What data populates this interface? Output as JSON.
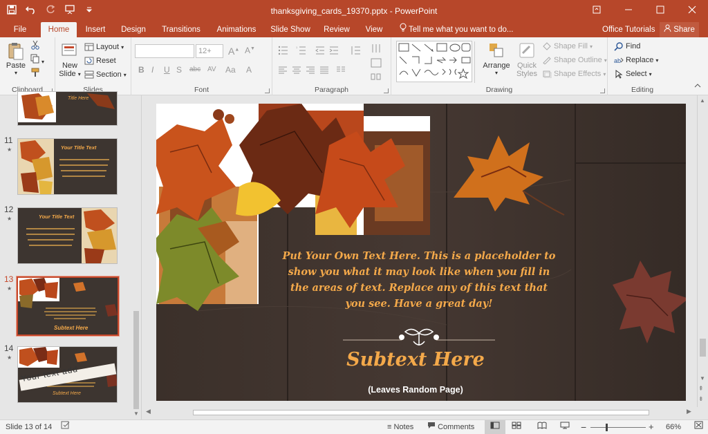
{
  "window": {
    "title": "thanksgiving_cards_19370.pptx - PowerPoint"
  },
  "qat": {
    "save": "save-icon",
    "undo": "undo-icon",
    "redo": "redo-icon",
    "present": "present-icon",
    "customize": "customize-icon"
  },
  "tabs": [
    {
      "label": "File"
    },
    {
      "label": "Home"
    },
    {
      "label": "Insert"
    },
    {
      "label": "Design"
    },
    {
      "label": "Transitions"
    },
    {
      "label": "Animations"
    },
    {
      "label": "Slide Show"
    },
    {
      "label": "Review"
    },
    {
      "label": "View"
    }
  ],
  "tell_me": "Tell me what you want to do...",
  "office_tutorials": "Office Tutorials",
  "share": "Share",
  "ribbon": {
    "clipboard": {
      "paste": "Paste",
      "label": "Clipboard"
    },
    "slides": {
      "new_slide_1": "New",
      "new_slide_2": "Slide",
      "layout": "Layout",
      "reset": "Reset",
      "section": "Section",
      "label": "Slides"
    },
    "font": {
      "size": "12+",
      "label": "Font",
      "buttons": [
        "B",
        "I",
        "U",
        "S",
        "abc",
        "AV",
        "Aa",
        "A"
      ]
    },
    "paragraph": {
      "label": "Paragraph"
    },
    "drawing": {
      "arrange": "Arrange",
      "quick_styles_1": "Quick",
      "quick_styles_2": "Styles",
      "shape_fill": "Shape Fill",
      "shape_outline": "Shape Outline",
      "shape_effects": "Shape Effects",
      "label": "Drawing"
    },
    "editing": {
      "find": "Find",
      "replace": "Replace",
      "select": "Select",
      "label": "Editing"
    }
  },
  "thumbnails": [
    {
      "number": "",
      "caption": "Title Here"
    },
    {
      "number": "11",
      "caption": "Your Title Text"
    },
    {
      "number": "12",
      "caption": "Your Title Text"
    },
    {
      "number": "13",
      "caption": "Subtext Here"
    },
    {
      "number": "14",
      "caption": "Subtext Here",
      "banner": "Your text add"
    }
  ],
  "slide": {
    "body": "Put Your Own Text Here. This is a placeholder to show you what it may look like when you fill in the areas of text. Replace any of this text that you see. Have a great day!",
    "subtitle": "Subtext Here",
    "caption": "(Leaves Random Page)"
  },
  "status": {
    "slide_info": "Slide 13 of 14",
    "notes": "Notes",
    "comments": "Comments",
    "zoom": "66%"
  },
  "colors": {
    "accent": "#b7472a",
    "slide_text": "#f4a94a"
  }
}
